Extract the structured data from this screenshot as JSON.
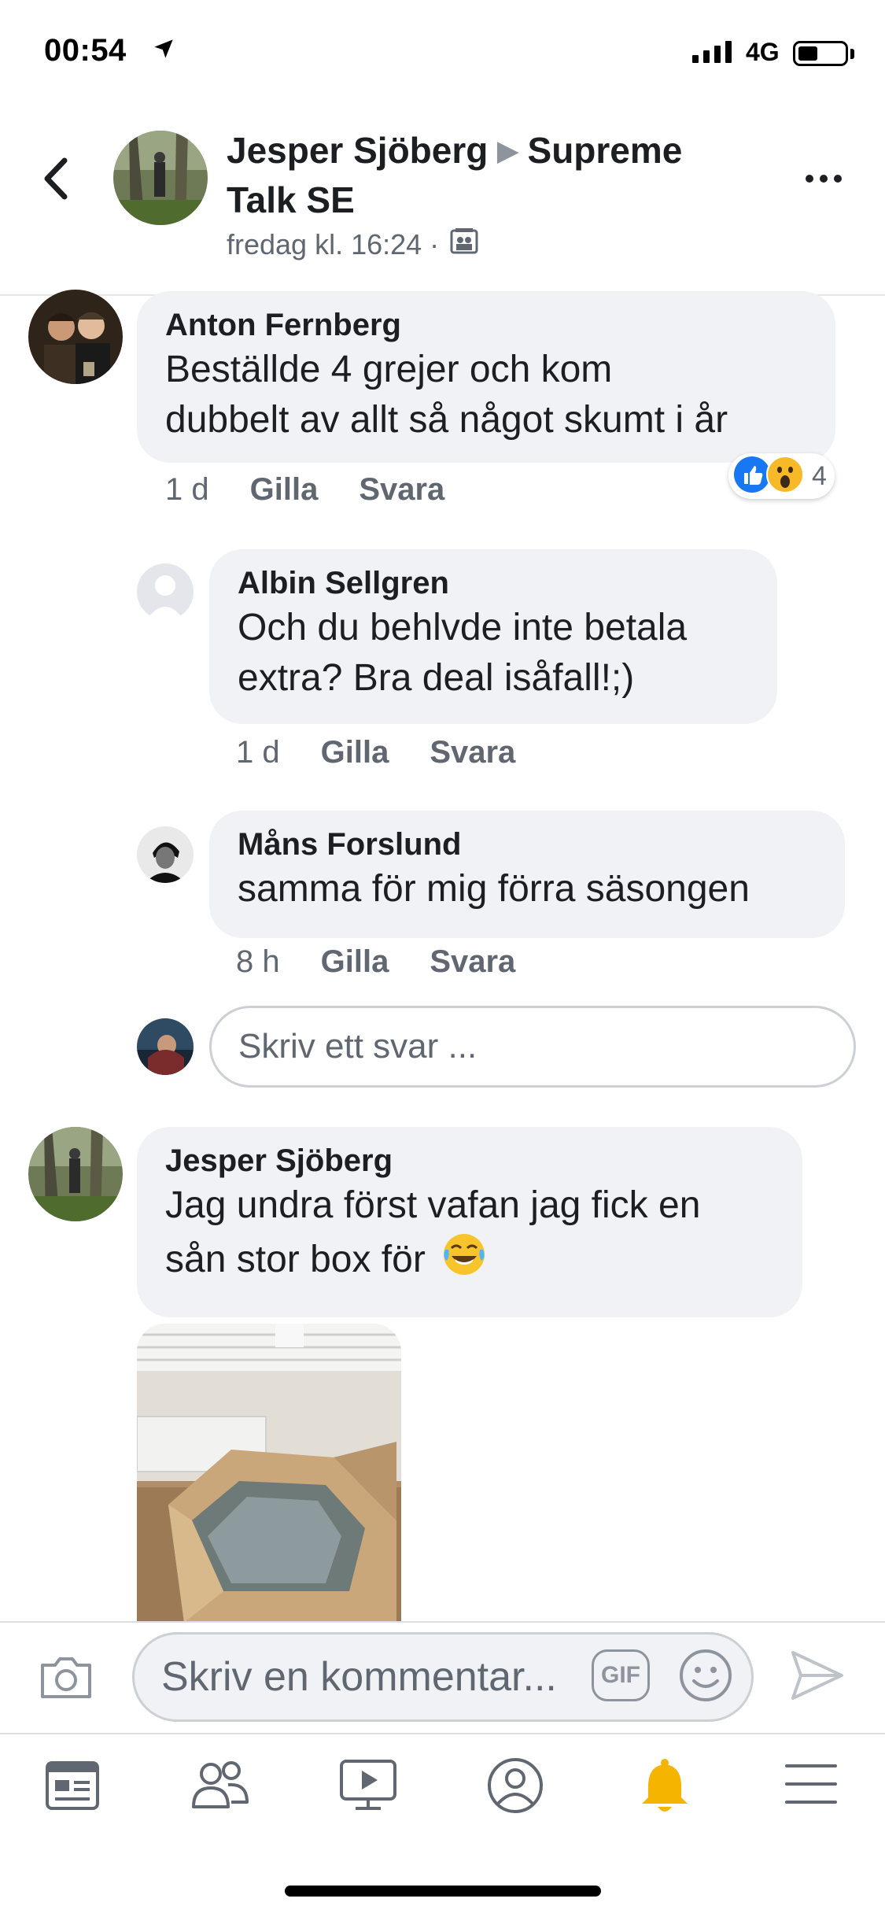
{
  "status_bar": {
    "time": "00:54",
    "network": "4G"
  },
  "header": {
    "author": "Jesper Sjöberg",
    "group_line1": "Supreme",
    "group_line2": "Talk SE",
    "timestamp": "fredag kl. 16:24 ·"
  },
  "comments": [
    {
      "name": "Anton Fernberg",
      "text_line1": "Beställde 4 grejer och kom",
      "text_line2": "dubbelt av allt så något skumt i år",
      "time": "1 d",
      "like": "Gilla",
      "reply": "Svara",
      "reactions_count": "4"
    },
    {
      "name": "Albin Sellgren",
      "text_line1": "Och du behlvde inte betala",
      "text_line2": "extra? Bra deal isåfall!;)",
      "time": "1 d",
      "like": "Gilla",
      "reply": "Svara"
    },
    {
      "name": "Måns Forslund",
      "text_line1": "samma för mig förra säsongen",
      "time": "8 h",
      "like": "Gilla",
      "reply": "Svara"
    },
    {
      "name": "Jesper Sjöberg",
      "text_line1": "Jag undra först vafan jag fick en",
      "text_line2": "sån stor box för"
    }
  ],
  "reply_input": {
    "placeholder": "Skriv ett svar ..."
  },
  "composer": {
    "placeholder": "Skriv en kommentar...",
    "gif_label": "GIF"
  },
  "tabs": [
    "news-feed-icon",
    "friends-icon",
    "watch-icon",
    "profile-icon",
    "notifications-bell-icon",
    "menu-icon"
  ],
  "colors": {
    "brand_blue": "#1877f2",
    "bell_yellow": "#f4b400",
    "bubble_gray": "#f0f2f5"
  }
}
